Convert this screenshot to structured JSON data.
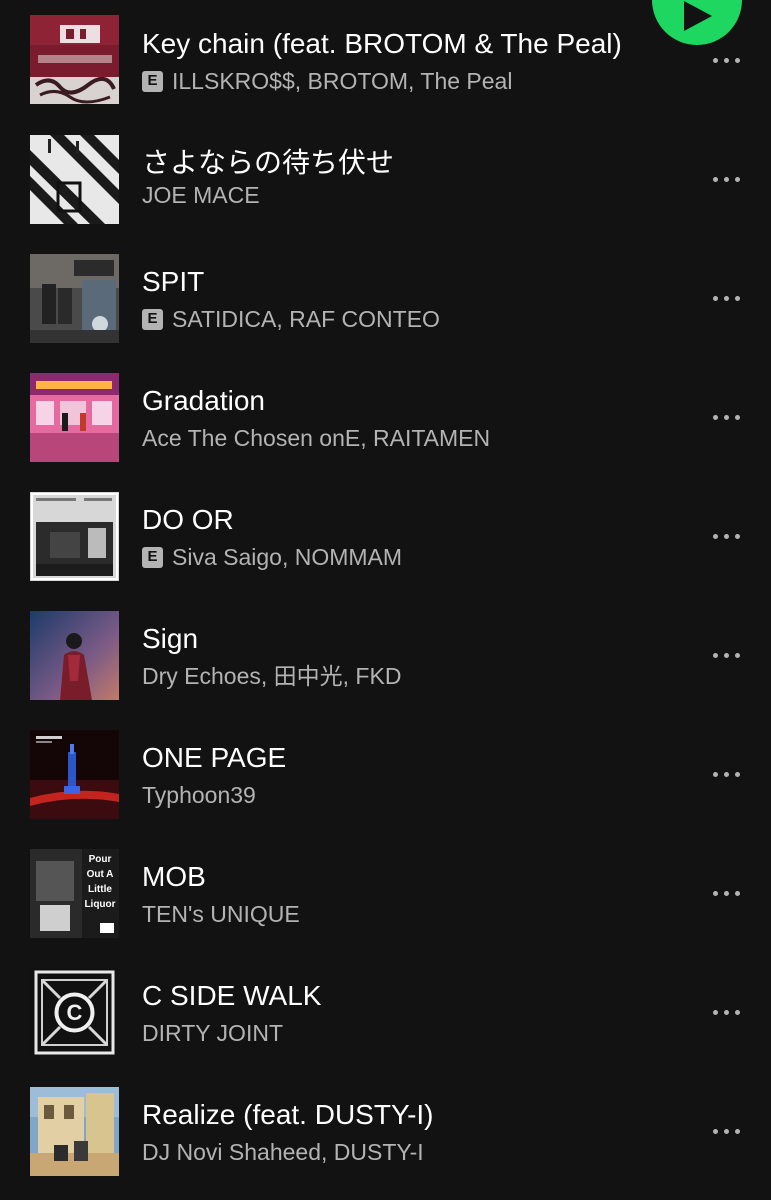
{
  "colors": {
    "background": "#121212",
    "accent": "#1ed760",
    "text_primary": "#ffffff",
    "text_secondary": "#b3b3b3"
  },
  "play_button": {
    "icon": "play-icon"
  },
  "tracks": [
    {
      "title": "Key chain (feat. BROTOM & The Peal)",
      "artists": "ILLSKRO$$, BROTOM, The Peal",
      "explicit": true,
      "explicit_label": "E"
    },
    {
      "title": "さよならの待ち伏せ",
      "artists": "JOE MACE",
      "explicit": false
    },
    {
      "title": "SPIT",
      "artists": "SATIDICA, RAF CONTEO",
      "explicit": true,
      "explicit_label": "E"
    },
    {
      "title": "Gradation",
      "artists": "Ace The Chosen onE, RAITAMEN",
      "explicit": false
    },
    {
      "title": "DO OR",
      "artists": "Siva Saigo, NOMMAM",
      "explicit": true,
      "explicit_label": "E"
    },
    {
      "title": "Sign",
      "artists": "Dry Echoes, 田中光, FKD",
      "explicit": false
    },
    {
      "title": "ONE PAGE",
      "artists": "Typhoon39",
      "explicit": false
    },
    {
      "title": "MOB",
      "artists": "TEN's UNIQUE",
      "explicit": false
    },
    {
      "title": "C SIDE WALK",
      "artists": "DIRTY JOINT",
      "explicit": false
    },
    {
      "title": "Realize (feat. DUSTY-I)",
      "artists": "DJ Novi Shaheed, DUSTY-I",
      "explicit": false
    }
  ],
  "cover_art": {
    "mob": [
      "Pour",
      "Out A",
      "Little",
      "Liquor"
    ]
  }
}
